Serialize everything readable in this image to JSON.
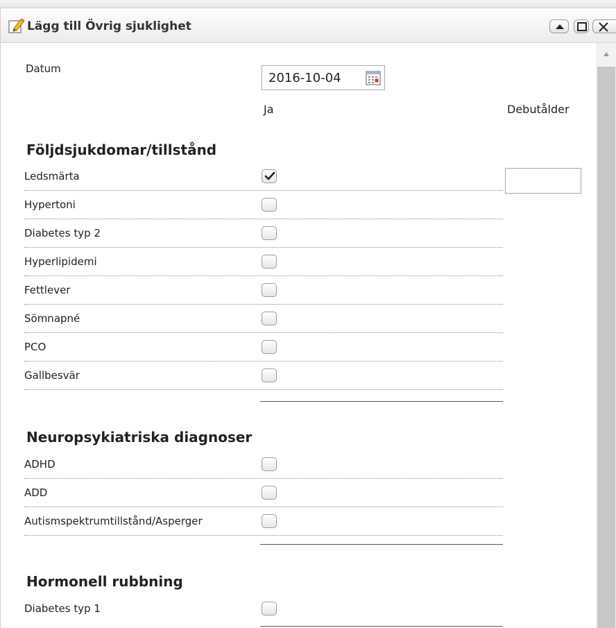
{
  "dialog": {
    "title": "Lägg till Övrig sjuklighet",
    "title_icon": "pencil-icon"
  },
  "form": {
    "datum_label": "Datum",
    "date_value": "2016-10-04",
    "col_ja": "Ja",
    "col_debut": "Debutålder",
    "debut_age_value": ""
  },
  "sections": [
    {
      "title": "Följdsjukdomar/tillstånd",
      "items": [
        {
          "label": "Ledsmärta",
          "checked": true
        },
        {
          "label": "Hypertoni",
          "checked": false
        },
        {
          "label": "Diabetes typ 2",
          "checked": false
        },
        {
          "label": "Hyperlipidemi",
          "checked": false
        },
        {
          "label": "Fettlever",
          "checked": false
        },
        {
          "label": "Sömnapné",
          "checked": false
        },
        {
          "label": "PCO",
          "checked": false
        },
        {
          "label": "Gallbesvär",
          "checked": false
        }
      ]
    },
    {
      "title": "Neuropsykiatriska diagnoser",
      "items": [
        {
          "label": "ADHD",
          "checked": false
        },
        {
          "label": "ADD",
          "checked": false
        },
        {
          "label": "Autismspektrumtillstånd/Asperger",
          "checked": false
        }
      ]
    },
    {
      "title": "Hormonell rubbning",
      "items": [
        {
          "label": "Diabetes typ 1",
          "checked": false
        }
      ]
    }
  ],
  "colors": {
    "titlebar_top": "#fdfdfd",
    "titlebar_bottom": "#ececec",
    "scroll_thumb": "#c7c7c7"
  }
}
